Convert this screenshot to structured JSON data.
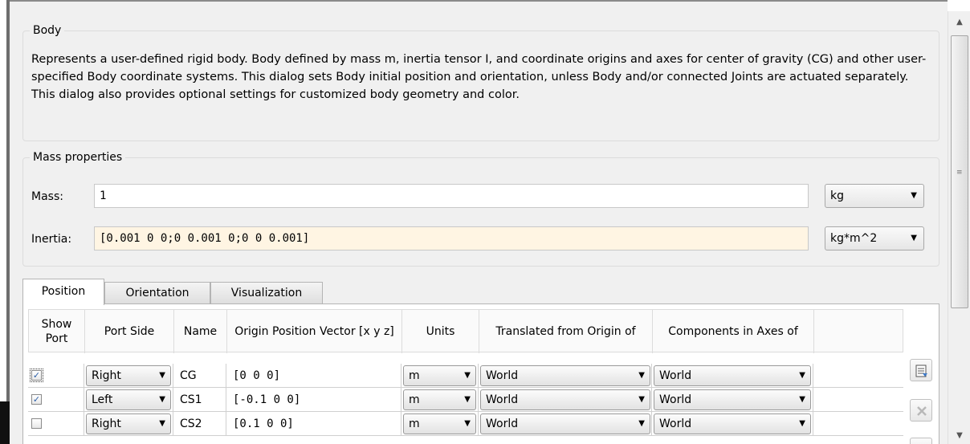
{
  "body_group": {
    "title": "Body",
    "description": "Represents a user-defined rigid body. Body defined by mass m, inertia tensor I, and coordinate origins and axes for center of gravity (CG) and other user-specified Body coordinate systems. This dialog sets Body initial position and orientation, unless Body and/or connected Joints are actuated separately. This dialog also provides optional settings for customized body geometry and color."
  },
  "mass_properties": {
    "title": "Mass properties",
    "mass_label": "Mass:",
    "mass_value": "1",
    "mass_unit": "kg",
    "inertia_label": "Inertia:",
    "inertia_value": "[0.001 0 0;0 0.001 0;0 0 0.001]",
    "inertia_unit": "kg*m^2"
  },
  "tabs": [
    {
      "label": "Position",
      "active": true
    },
    {
      "label": "Orientation",
      "active": false
    },
    {
      "label": "Visualization",
      "active": false
    }
  ],
  "table": {
    "headers": {
      "show_port": "Show Port",
      "port_side": "Port Side",
      "name": "Name",
      "origin": "Origin Position Vector [x y z]",
      "units": "Units",
      "translated": "Translated from Origin of",
      "components": "Components in Axes of"
    },
    "rows": [
      {
        "show_port": true,
        "port_side": "Right",
        "name": "CG",
        "origin": "[0 0 0]",
        "units": "m",
        "translated": "World",
        "components": "World"
      },
      {
        "show_port": true,
        "port_side": "Left",
        "name": "CS1",
        "origin": "[-0.1 0 0]",
        "units": "m",
        "translated": "World",
        "components": "World"
      },
      {
        "show_port": false,
        "port_side": "Right",
        "name": "CS2",
        "origin": "[0.1 0 0]",
        "units": "m",
        "translated": "World",
        "components": "World"
      }
    ]
  },
  "icons": {
    "add_row": "add-row-icon",
    "delete_row": "delete-row-icon",
    "dropdown": "chevron-down-icon",
    "check": "✓"
  },
  "colors": {
    "dialog_bg": "#f0f0f0",
    "warning_field_bg": "#fff5e3",
    "delete_icon_disabled": "#b8b8b8"
  }
}
